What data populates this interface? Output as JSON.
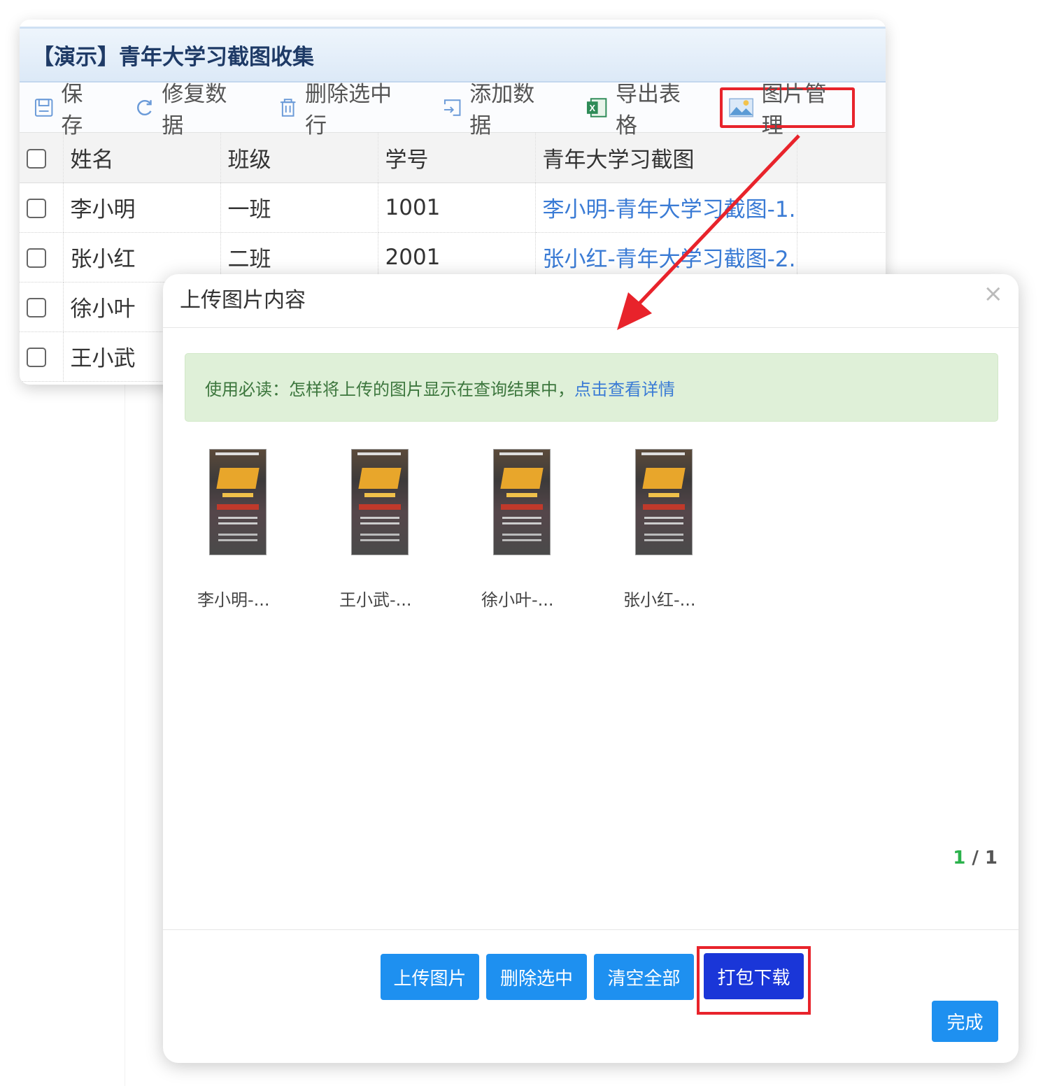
{
  "window": {
    "title": "【演示】青年大学习截图收集"
  },
  "toolbar": {
    "save": "保存",
    "repair": "修复数据",
    "delete_rows": "删除选中行",
    "add_data": "添加数据",
    "export": "导出表格",
    "image_manage": "图片管理"
  },
  "table": {
    "headers": [
      "姓名",
      "班级",
      "学号",
      "青年大学习截图"
    ],
    "rows": [
      {
        "name": "李小明",
        "class": "一班",
        "id": "1001",
        "screenshot": "李小明-青年大学习截图-1."
      },
      {
        "name": "张小红",
        "class": "二班",
        "id": "2001",
        "screenshot": "张小红-青年大学习截图-2."
      },
      {
        "name": "徐小叶",
        "class": "",
        "id": "",
        "screenshot": ""
      },
      {
        "name": "王小武",
        "class": "",
        "id": "",
        "screenshot": ""
      }
    ]
  },
  "dialog": {
    "title": "上传图片内容",
    "close": "×",
    "notice_text": "使用必读：怎样将上传的图片显示在查询结果中，",
    "notice_link": "点击查看详情",
    "thumbnails": [
      {
        "caption": "李小明-..."
      },
      {
        "caption": "王小武-..."
      },
      {
        "caption": "徐小叶-..."
      },
      {
        "caption": "张小红-..."
      }
    ],
    "pager": {
      "current": "1",
      "sep": " / ",
      "total": "1"
    },
    "buttons": {
      "upload": "上传图片",
      "delete_selected": "删除选中",
      "clear_all": "清空全部",
      "download_zip": "打包下载",
      "done": "完成"
    }
  },
  "colors": {
    "accent": "#1e90f0",
    "download_button": "#1a36d8",
    "highlight_box": "#e8232b",
    "link": "#3a7bd5",
    "notice_bg": "#dff0d8"
  }
}
